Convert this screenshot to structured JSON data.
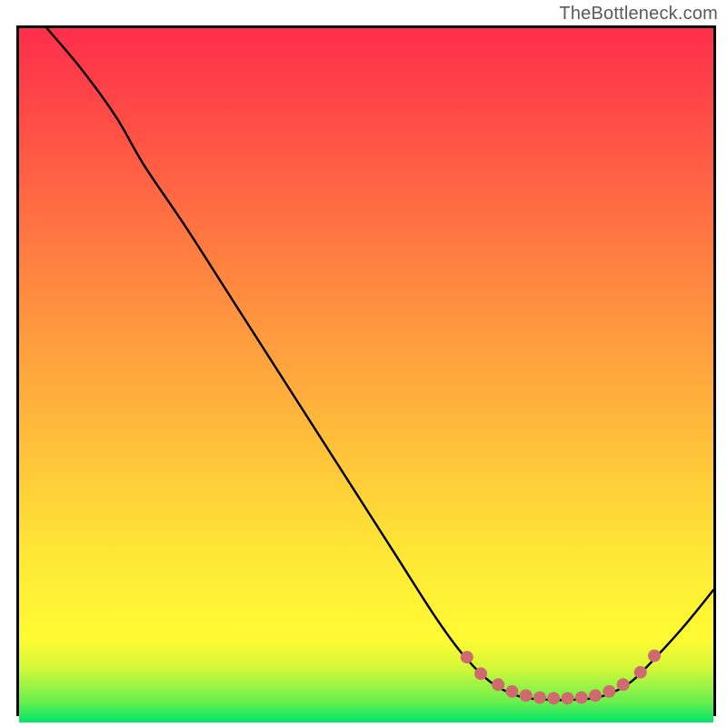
{
  "watermark": "TheBottleneck.com",
  "chart_data": {
    "type": "line",
    "title": "",
    "xlabel": "",
    "ylabel": "",
    "xlim": [
      0,
      100
    ],
    "ylim": [
      0,
      100
    ],
    "gradient_stops": [
      {
        "offset": 0.0,
        "color": "#00e56a"
      },
      {
        "offset": 0.03,
        "color": "#6af04e"
      },
      {
        "offset": 0.08,
        "color": "#d6f838"
      },
      {
        "offset": 0.12,
        "color": "#fffb33"
      },
      {
        "offset": 0.25,
        "color": "#ffe636"
      },
      {
        "offset": 0.45,
        "color": "#ffb43b"
      },
      {
        "offset": 0.65,
        "color": "#ff8440"
      },
      {
        "offset": 0.85,
        "color": "#ff5145"
      },
      {
        "offset": 1.0,
        "color": "#ff2e4b"
      }
    ],
    "series": [
      {
        "name": "bottleneck-curve",
        "stroke": "#000000",
        "stroke_width": 2,
        "points": [
          {
            "x": 4,
            "y": 100
          },
          {
            "x": 9,
            "y": 94
          },
          {
            "x": 14,
            "y": 87
          },
          {
            "x": 18,
            "y": 80
          },
          {
            "x": 24,
            "y": 71
          },
          {
            "x": 30,
            "y": 61.5
          },
          {
            "x": 36,
            "y": 52
          },
          {
            "x": 42,
            "y": 42.5
          },
          {
            "x": 48,
            "y": 33
          },
          {
            "x": 54,
            "y": 23.5
          },
          {
            "x": 60,
            "y": 14
          },
          {
            "x": 64,
            "y": 8.5
          },
          {
            "x": 68,
            "y": 4.5
          },
          {
            "x": 72,
            "y": 2.5
          },
          {
            "x": 76,
            "y": 2
          },
          {
            "x": 80,
            "y": 2
          },
          {
            "x": 84,
            "y": 2.5
          },
          {
            "x": 88,
            "y": 4.5
          },
          {
            "x": 92,
            "y": 8.5
          },
          {
            "x": 96,
            "y": 13
          },
          {
            "x": 100,
            "y": 18
          }
        ]
      },
      {
        "name": "optimal-range-dots",
        "stroke": "#cf6a6f",
        "marker": "dot",
        "marker_size": 7,
        "points": [
          {
            "x": 64.5,
            "y": 8.2
          },
          {
            "x": 66.5,
            "y": 5.8
          },
          {
            "x": 69,
            "y": 4.2
          },
          {
            "x": 71,
            "y": 3.2
          },
          {
            "x": 73,
            "y": 2.6
          },
          {
            "x": 75,
            "y": 2.3
          },
          {
            "x": 77,
            "y": 2.2
          },
          {
            "x": 79,
            "y": 2.2
          },
          {
            "x": 81,
            "y": 2.3
          },
          {
            "x": 83,
            "y": 2.6
          },
          {
            "x": 85,
            "y": 3.2
          },
          {
            "x": 87,
            "y": 4.2
          },
          {
            "x": 89.5,
            "y": 6.0
          },
          {
            "x": 91.5,
            "y": 8.4
          }
        ]
      }
    ]
  }
}
